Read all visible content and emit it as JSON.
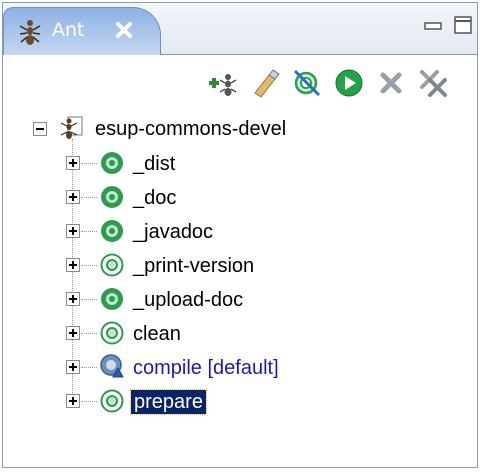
{
  "view": {
    "tab_title": "Ant"
  },
  "toolbar": {
    "buttons": [
      {
        "name": "add-buildfiles-icon"
      },
      {
        "name": "add-buildfiles-search-icon"
      },
      {
        "name": "hide-internal-targets-icon"
      },
      {
        "name": "run-target-icon"
      },
      {
        "name": "remove-icon"
      },
      {
        "name": "remove-all-icon"
      }
    ]
  },
  "tree": {
    "project": "esup-commons-devel",
    "targets": [
      {
        "label": "_dist",
        "kind": "public"
      },
      {
        "label": "_doc",
        "kind": "public"
      },
      {
        "label": "_javadoc",
        "kind": "public"
      },
      {
        "label": "_print-version",
        "kind": "internal"
      },
      {
        "label": "_upload-doc",
        "kind": "public"
      },
      {
        "label": "clean",
        "kind": "internal"
      },
      {
        "label": "compile [default]",
        "kind": "default"
      },
      {
        "label": "prepare",
        "kind": "internal",
        "selected": true
      }
    ]
  },
  "colors": {
    "tab_gradient_top": "#8cb1e3",
    "default_target_text": "#1a1ab8",
    "selection_bg": "#0a246a",
    "target_green": "#2e9b4f"
  }
}
